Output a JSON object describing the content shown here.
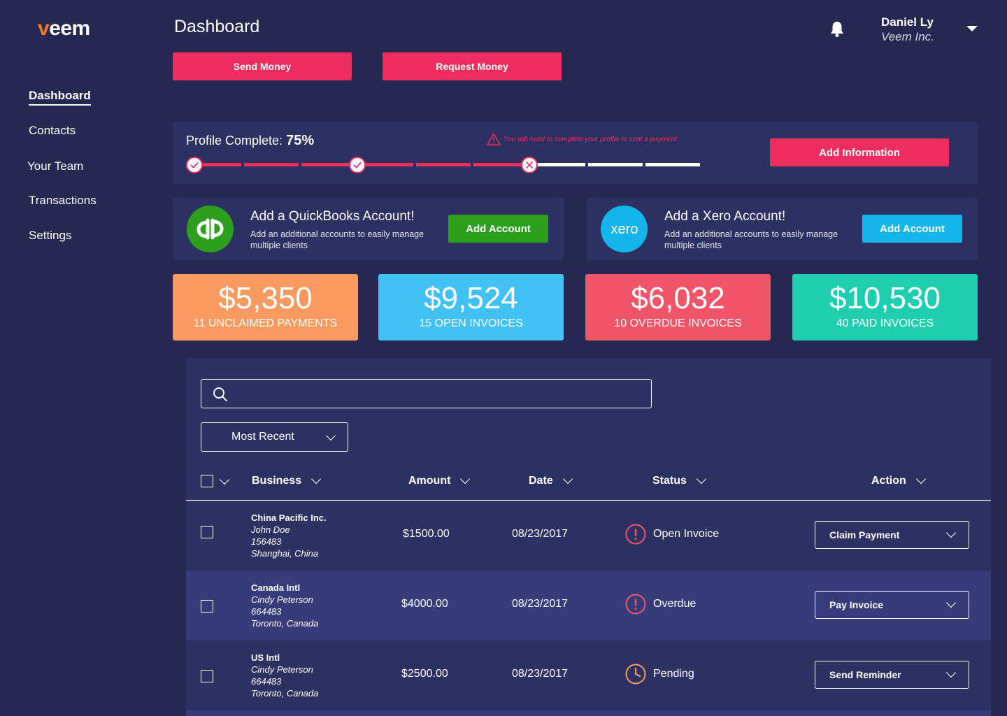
{
  "brand": {
    "logo_first": "v",
    "logo_rest": "eem",
    "accent": "#f47a24"
  },
  "sidebar": {
    "items": [
      {
        "label": "Dashboard",
        "active": true
      },
      {
        "label": "Contacts"
      },
      {
        "label": "Your Team"
      },
      {
        "label": "Transactions"
      },
      {
        "label": "Settings"
      }
    ]
  },
  "header": {
    "title": "Dashboard",
    "notification_icon": "bell-icon",
    "user": {
      "name": "Daniel Ly",
      "org": "Veem Inc."
    }
  },
  "actions": {
    "send_money": "Send Money",
    "request_money": "Request Money"
  },
  "profile": {
    "label": "Profile Complete:",
    "percent_text": "75%",
    "percent": 75,
    "warning": "You will need to complete your profile to sent a payment.",
    "button": "Add Information",
    "steps": [
      "complete",
      "complete",
      "error"
    ]
  },
  "integrations": {
    "quickbooks": {
      "logo": "qb",
      "title": "Add a QuickBooks Account!",
      "subtitle": "Add an additional accounts to easily manage multiple  clients",
      "button": "Add Account",
      "color": "#2ca01c"
    },
    "xero": {
      "logo": "xero",
      "title": "Add a Xero Account!",
      "subtitle": "Add an additional accounts to easily manage multiple  clients",
      "button": "Add Account",
      "color": "#13b5ea"
    }
  },
  "stats": [
    {
      "value": "$5,350",
      "label": "11 Unclaimed payments",
      "color": "#f99b60"
    },
    {
      "value": "$9,524",
      "label": "15 Open invoices",
      "color": "#42c1f5"
    },
    {
      "value": "$6,032",
      "label": "10 Overdue invoices",
      "color": "#f25468"
    },
    {
      "value": "$10,530",
      "label": "40 Paid invoices",
      "color": "#1dcfae"
    }
  ],
  "table": {
    "search_placeholder": "",
    "sort": "Most Recent",
    "columns": [
      "Business",
      "Amount",
      "Date",
      "Status",
      "Action"
    ],
    "rows": [
      {
        "business": "China Pacific Inc.",
        "contact": "John Doe",
        "id": "156483",
        "location": "Shanghai, China",
        "amount": "$1500.00",
        "date": "08/23/2017",
        "status": "Open Invoice",
        "status_icon": "alert-circle-icon",
        "action": "Claim Payment"
      },
      {
        "business": "Canada Intl",
        "contact": "Cindy Peterson",
        "id": "664483",
        "location": "Toronto, Canada",
        "amount": "$4000.00",
        "date": "08/23/2017",
        "status": "Overdue",
        "status_icon": "alert-circle-icon",
        "action": "Pay Invoice"
      },
      {
        "business": "US Intl",
        "contact": "Cindy Peterson",
        "id": "664483",
        "location": "Toronto, Canada",
        "amount": "$2500.00",
        "date": "08/23/2017",
        "status": "Pending",
        "status_icon": "clock-icon",
        "action": "Send Reminder"
      }
    ]
  }
}
